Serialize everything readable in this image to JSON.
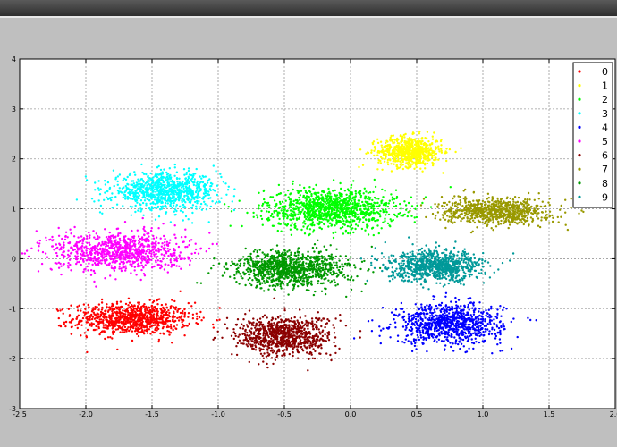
{
  "chart_data": {
    "type": "scatter",
    "title": "",
    "xlabel": "",
    "ylabel": "",
    "xlim": [
      -2.5,
      2.0
    ],
    "ylim": [
      -3,
      4
    ],
    "xticks": [
      "-2.5",
      "-2.0",
      "-1.5",
      "-1.0",
      "-0.5",
      "0.0",
      "0.5",
      "1.0",
      "1.5",
      "2.0"
    ],
    "xtick_values": [
      -2.5,
      -2.0,
      -1.5,
      -1.0,
      -0.5,
      0.0,
      0.5,
      1.0,
      1.5,
      2.0
    ],
    "yticks": [
      "-3",
      "-2",
      "-1",
      "0",
      "1",
      "2",
      "3",
      "4"
    ],
    "ytick_values": [
      -3,
      -2,
      -1,
      0,
      1,
      2,
      3,
      4
    ],
    "grid": true,
    "legend_position": "top-right",
    "series": [
      {
        "name": "0",
        "color": "#ff0000",
        "center": [
          -1.65,
          -1.2
        ],
        "spread": [
          0.22,
          0.16
        ],
        "count": 900
      },
      {
        "name": "1",
        "color": "#ffff00",
        "center": [
          0.45,
          2.15
        ],
        "spread": [
          0.12,
          0.15
        ],
        "count": 700
      },
      {
        "name": "2",
        "color": "#00ff00",
        "center": [
          -0.15,
          1.0
        ],
        "spread": [
          0.25,
          0.2
        ],
        "count": 1100
      },
      {
        "name": "3",
        "color": "#00ffff",
        "center": [
          -1.4,
          1.35
        ],
        "spread": [
          0.2,
          0.18
        ],
        "count": 900
      },
      {
        "name": "4",
        "color": "#0000ff",
        "center": [
          0.75,
          -1.3
        ],
        "spread": [
          0.2,
          0.2
        ],
        "count": 900
      },
      {
        "name": "5",
        "color": "#ff00ff",
        "center": [
          -1.75,
          0.15
        ],
        "spread": [
          0.25,
          0.2
        ],
        "count": 900
      },
      {
        "name": "6",
        "color": "#8b0000",
        "center": [
          -0.5,
          -1.55
        ],
        "spread": [
          0.18,
          0.2
        ],
        "count": 850
      },
      {
        "name": "7",
        "color": "#999900",
        "center": [
          1.1,
          0.95
        ],
        "spread": [
          0.2,
          0.13
        ],
        "count": 800
      },
      {
        "name": "8",
        "color": "#009900",
        "center": [
          -0.45,
          -0.2
        ],
        "spread": [
          0.22,
          0.18
        ],
        "count": 1000
      },
      {
        "name": "9",
        "color": "#009999",
        "center": [
          0.65,
          -0.15
        ],
        "spread": [
          0.18,
          0.15
        ],
        "count": 850
      }
    ]
  }
}
